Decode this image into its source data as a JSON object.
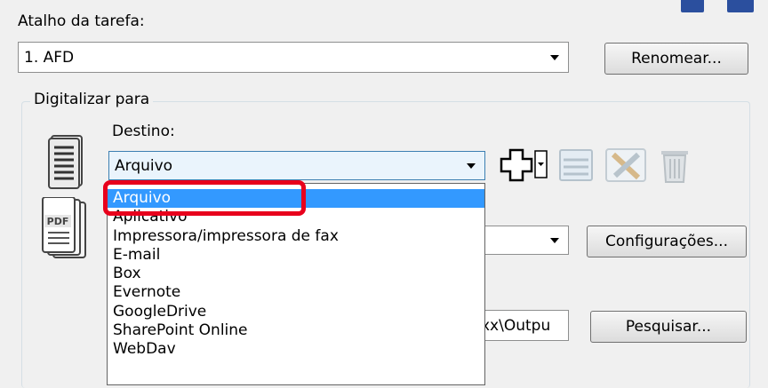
{
  "task_shortcut": {
    "label": "Atalho da tarefa:",
    "selected": "1. AFD",
    "rename_button": "Renomear..."
  },
  "scan_to": {
    "group_label": "Digitalizar para",
    "destination_label": "Destino:",
    "destination_selected": "Arquivo",
    "settings_button": "Configurações...",
    "path_value": "xx\\Outpu",
    "browse_button": "Pesquisar..."
  },
  "destination_options": [
    "Arquivo",
    "Aplicativo",
    "Impressora/impressora de fax",
    "E-mail",
    "Box",
    "Evernote",
    "GoogleDrive",
    "SharePoint Online",
    "WebDav"
  ],
  "icons": {
    "document": "document-icon",
    "pdf": "pdf-icon",
    "add": "add-destination-icon",
    "edit": "edit-destination-icon",
    "tools": "tools-destination-icon",
    "delete": "trash-icon"
  },
  "colors": {
    "selection": "#3399ff",
    "annotation": "#e8001c"
  }
}
